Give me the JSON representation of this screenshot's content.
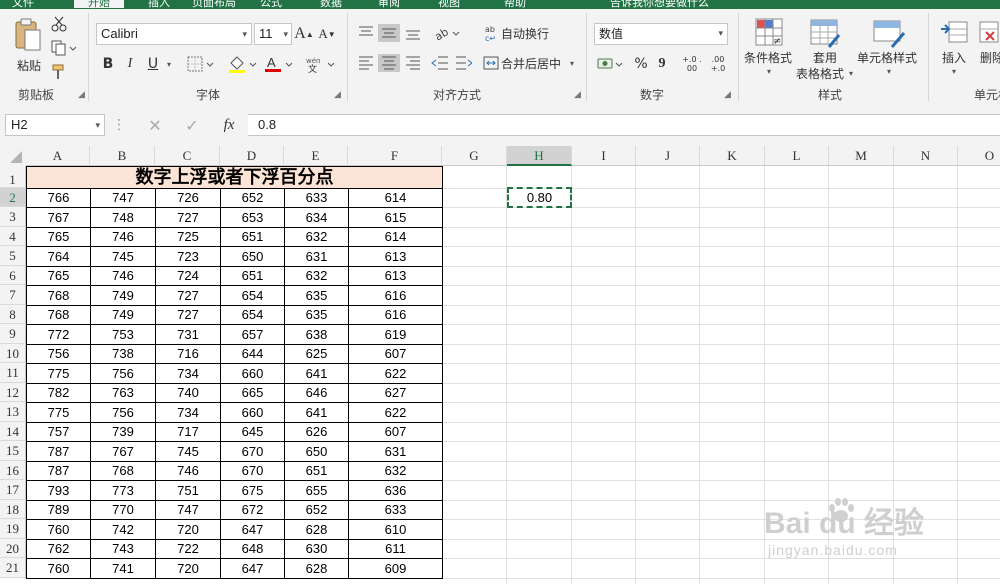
{
  "menu": {
    "tabs": [
      "文件",
      "开始",
      "插入",
      "页面布局",
      "公式",
      "数据",
      "审阅",
      "视图",
      "帮助",
      "告诉我你想要做什么"
    ]
  },
  "ribbon": {
    "clipboard": {
      "paste": "粘贴",
      "label": "剪贴板"
    },
    "font": {
      "name": "Calibri",
      "size": "11",
      "grow": "A",
      "shrink": "A",
      "bold": "B",
      "italic": "I",
      "underline": "U",
      "font_color_glyph": "A",
      "label": "字体"
    },
    "alignment": {
      "wrap": "自动换行",
      "merge": "合并后居中",
      "label": "对齐方式"
    },
    "number": {
      "format": "数值",
      "percent": "%",
      "comma": "9",
      "inc": "+.0 .00",
      "dec": ".00 +.0",
      "label": "数字"
    },
    "styles": {
      "conditional": "条件格式",
      "table1": "套用",
      "table2": "表格格式",
      "cell_styles": "单元格样式",
      "label": "样式"
    },
    "cells": {
      "insert": "插入",
      "delete": "删除",
      "label": "单元格"
    }
  },
  "formula_bar": {
    "name_box": "H2",
    "fx": "fx",
    "value": "0.8"
  },
  "sheet": {
    "columns": [
      "A",
      "B",
      "C",
      "D",
      "E",
      "F",
      "G",
      "H",
      "I",
      "J",
      "K",
      "L",
      "M",
      "N",
      "O"
    ],
    "selected_column": "H",
    "selected_row": "2",
    "title": "数字上浮或者下浮百分点",
    "active_cell_value": "0.80",
    "rows": [
      {
        "n": "1",
        "v": []
      },
      {
        "n": "2",
        "v": [
          "766",
          "747",
          "726",
          "652",
          "633",
          "614"
        ]
      },
      {
        "n": "3",
        "v": [
          "767",
          "748",
          "727",
          "653",
          "634",
          "615"
        ]
      },
      {
        "n": "4",
        "v": [
          "765",
          "746",
          "725",
          "651",
          "632",
          "614"
        ]
      },
      {
        "n": "5",
        "v": [
          "764",
          "745",
          "723",
          "650",
          "631",
          "613"
        ]
      },
      {
        "n": "6",
        "v": [
          "765",
          "746",
          "724",
          "651",
          "632",
          "613"
        ]
      },
      {
        "n": "7",
        "v": [
          "768",
          "749",
          "727",
          "654",
          "635",
          "616"
        ]
      },
      {
        "n": "8",
        "v": [
          "768",
          "749",
          "727",
          "654",
          "635",
          "616"
        ]
      },
      {
        "n": "9",
        "v": [
          "772",
          "753",
          "731",
          "657",
          "638",
          "619"
        ]
      },
      {
        "n": "10",
        "v": [
          "756",
          "738",
          "716",
          "644",
          "625",
          "607"
        ]
      },
      {
        "n": "11",
        "v": [
          "775",
          "756",
          "734",
          "660",
          "641",
          "622"
        ]
      },
      {
        "n": "12",
        "v": [
          "782",
          "763",
          "740",
          "665",
          "646",
          "627"
        ]
      },
      {
        "n": "13",
        "v": [
          "775",
          "756",
          "734",
          "660",
          "641",
          "622"
        ]
      },
      {
        "n": "14",
        "v": [
          "757",
          "739",
          "717",
          "645",
          "626",
          "607"
        ]
      },
      {
        "n": "15",
        "v": [
          "787",
          "767",
          "745",
          "670",
          "650",
          "631"
        ]
      },
      {
        "n": "16",
        "v": [
          "787",
          "768",
          "746",
          "670",
          "651",
          "632"
        ]
      },
      {
        "n": "17",
        "v": [
          "793",
          "773",
          "751",
          "675",
          "655",
          "636"
        ]
      },
      {
        "n": "18",
        "v": [
          "789",
          "770",
          "747",
          "672",
          "652",
          "633"
        ]
      },
      {
        "n": "19",
        "v": [
          "760",
          "742",
          "720",
          "647",
          "628",
          "610"
        ]
      },
      {
        "n": "20",
        "v": [
          "762",
          "743",
          "722",
          "648",
          "630",
          "611"
        ]
      },
      {
        "n": "21",
        "v": [
          "760",
          "741",
          "720",
          "647",
          "628",
          "609"
        ]
      }
    ]
  },
  "watermark": {
    "brand": "Bai du 经验",
    "url": "jingyan.baidu.com"
  },
  "colors": {
    "excel_green": "#217346",
    "title_fill": "#fce4d6"
  }
}
